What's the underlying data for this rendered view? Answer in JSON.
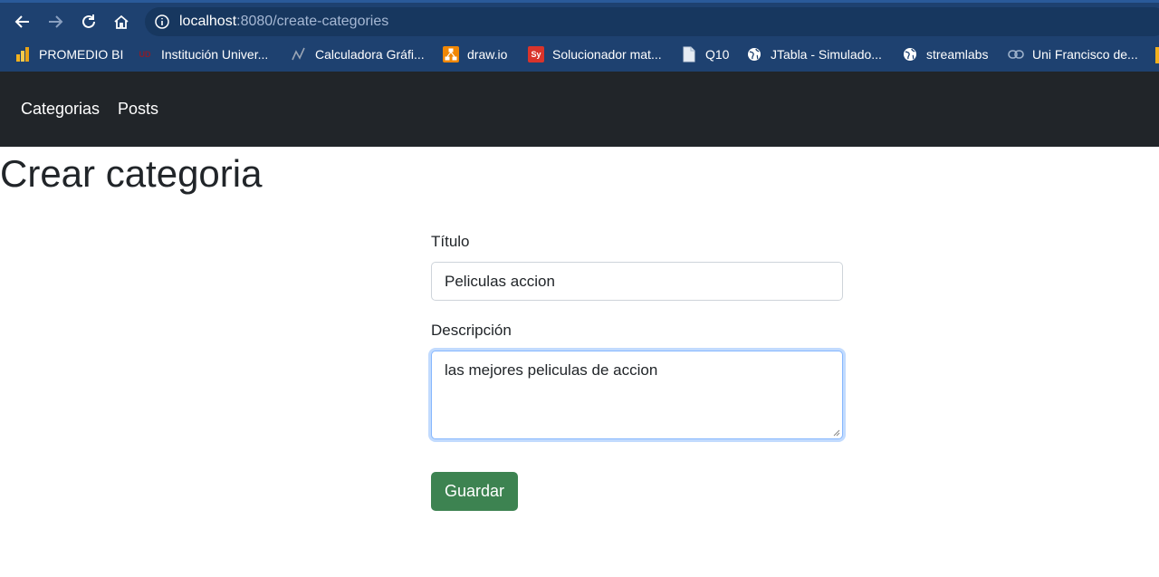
{
  "browser": {
    "url_host": "localhost",
    "url_path": ":8080/create-categories",
    "bookmarks": [
      {
        "label": "PROMEDIO BI",
        "icon": "bar-chart-icon",
        "color": "#f2b01e"
      },
      {
        "label": "Institución Univer...",
        "icon": "university-logo-icon",
        "color": "#8a1d2b"
      },
      {
        "label": "Calculadora Gráfi...",
        "icon": "graph-icon",
        "color": "#9aa5b5"
      },
      {
        "label": "draw.io",
        "icon": "drawio-icon",
        "color": "#f08705"
      },
      {
        "label": "Solucionador mat...",
        "icon": "symbolab-icon",
        "color": "#d9342b"
      },
      {
        "label": "Q10",
        "icon": "document-icon",
        "color": "#c9d3e0"
      },
      {
        "label": "JTabla - Simulado...",
        "icon": "globe-icon",
        "color": "#ffffff"
      },
      {
        "label": "streamlabs",
        "icon": "globe-icon",
        "color": "#ffffff"
      },
      {
        "label": "Uni Francisco de...",
        "icon": "link-icon",
        "color": "#9fb3cc"
      }
    ]
  },
  "navbar": {
    "links": [
      "Categorias",
      "Posts"
    ]
  },
  "page": {
    "title": "Crear categoria"
  },
  "form": {
    "title_label": "Título",
    "title_value": "Peliculas accion",
    "description_label": "Descripción",
    "description_value": "las mejores peliculas de accion",
    "submit_label": "Guardar"
  },
  "colors": {
    "navbar_bg": "#212529",
    "submit_bg": "#3d8351",
    "chrome_bg": "#1e4170"
  }
}
